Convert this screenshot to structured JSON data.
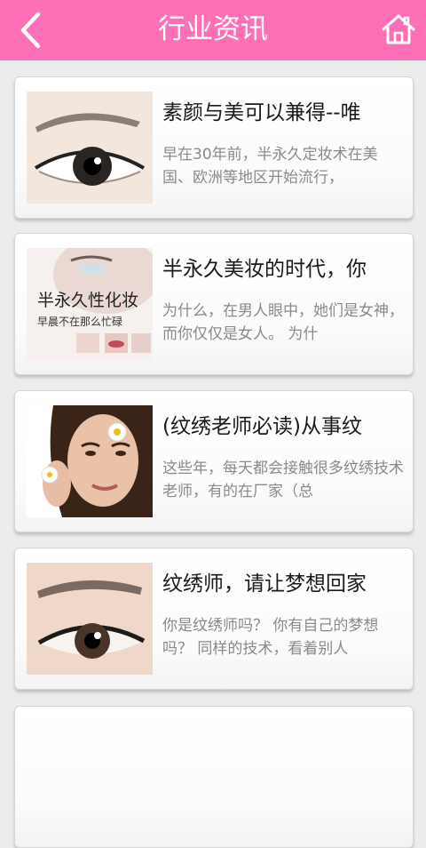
{
  "header": {
    "title": "行业资讯",
    "back_icon": "chevron-left-icon",
    "home_icon": "home-icon",
    "color": "#fd6fb7"
  },
  "articles": [
    {
      "title": "素颜与美可以兼得--唯",
      "desc": "早在30年前，半永久定妆术在美国、欧洲等地区开始流行，"
    },
    {
      "title": "半永久美妆的时代，你",
      "desc": "为什么，在男人眼中，她们是女神，而你仅仅是女人。 为什",
      "thumb_text": "半永久性化妆",
      "thumb_sub": "早晨不在那么忙碌"
    },
    {
      "title": "(纹绣老师必读)从事纹",
      "desc": "这些年，每天都会接触很多纹绣技术老师，有的在厂家（总"
    },
    {
      "title": "纹绣师，请让梦想回家",
      "desc": "你是纹绣师吗？ 你有自己的梦想吗？ 同样的技术，看着别人"
    }
  ]
}
